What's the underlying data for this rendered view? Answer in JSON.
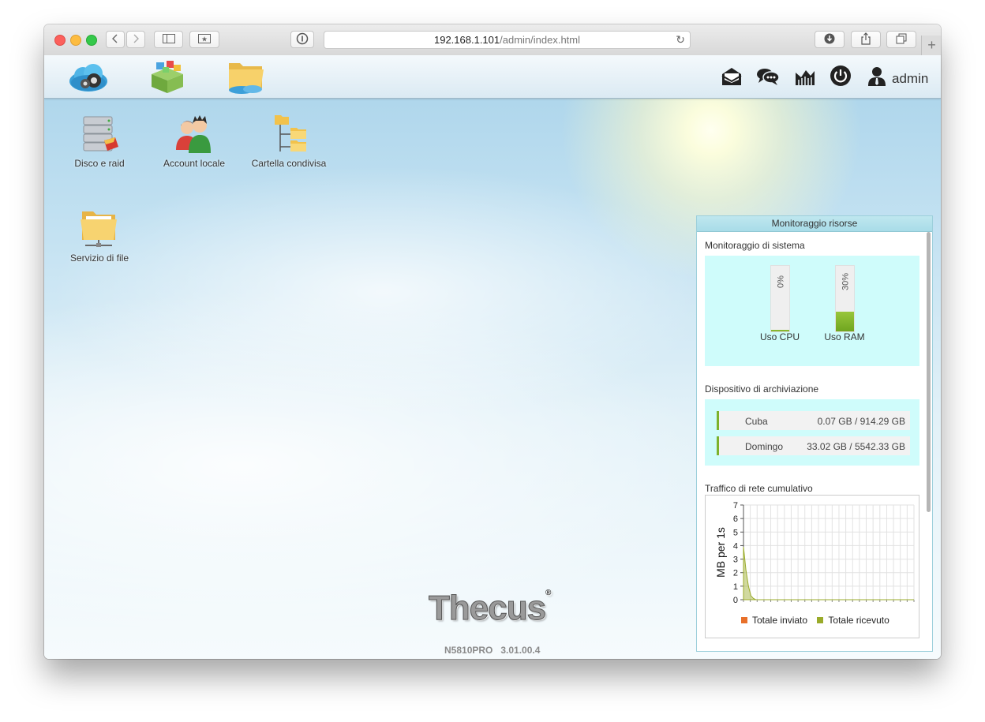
{
  "browser": {
    "address_host": "192.168.1.101",
    "address_path": "/admin/index.html",
    "reload_glyph": "↻",
    "new_tab_glyph": "+",
    "icons": [
      "back-icon",
      "forward-icon",
      "sidebar-icon",
      "bookmarks-icon",
      "reader-icon",
      "reload-icon",
      "download-icon",
      "share-icon",
      "tabs-icon"
    ]
  },
  "topbar": {
    "app_icons": [
      "cloud-settings-icon",
      "app-center-icon",
      "file-station-icon"
    ],
    "right_icons": [
      "message-icon",
      "chat-icon",
      "monitor-icon",
      "power-icon",
      "user-icon"
    ],
    "user_label": "admin"
  },
  "desktop": {
    "items": [
      {
        "label": "Disco e raid",
        "icon": "disk-raid-icon"
      },
      {
        "label": "Account locale",
        "icon": "local-account-icon"
      },
      {
        "label": "Cartella condivisa",
        "icon": "shared-folder-icon"
      },
      {
        "label": "Servizio di file",
        "icon": "file-service-icon"
      }
    ]
  },
  "branding": {
    "logo": "Thecus",
    "reg_mark": "®",
    "version": "N5810PRO   3.01.00.4"
  },
  "monitor": {
    "title": "Monitoraggio risorse",
    "system_title": "Monitoraggio di sistema",
    "cpu": {
      "label": "Uso CPU",
      "percent_text": "0%",
      "level": 0.02
    },
    "ram": {
      "label": "Uso RAM",
      "percent_text": "30%",
      "level": 0.3
    },
    "storage_title": "Dispositivo di archiviazione",
    "disks": [
      {
        "name": "Cuba",
        "usage": "0.07 GB / 914.29 GB"
      },
      {
        "name": "Domingo",
        "usage": "33.02 GB / 5542.33 GB"
      }
    ],
    "network_title": "Traffico di rete cumulativo",
    "colors": {
      "sent": "#e8702a",
      "received": "#9aab2a",
      "panel_header": "#a8dce8",
      "cyan_box": "#cffcfb"
    }
  },
  "chart_data": {
    "type": "area",
    "ylabel": "MB per 1s",
    "xlabel": "",
    "ylim": [
      0,
      7
    ],
    "yticks": [
      "0",
      "1",
      "2",
      "3",
      "4",
      "5",
      "6",
      "7"
    ],
    "grid": true,
    "legend_position": "bottom",
    "series": [
      {
        "name": "Totale inviato",
        "color": "#e8702a",
        "values": [
          0,
          0,
          0,
          0,
          0,
          0,
          0,
          0,
          0,
          0,
          0,
          0,
          0,
          0,
          0,
          0,
          0,
          0,
          0,
          0,
          0,
          0,
          0,
          0,
          0,
          0,
          0,
          0,
          0,
          0,
          0,
          0,
          0,
          0,
          0,
          0,
          0,
          0,
          0,
          0,
          0,
          0,
          0,
          0,
          0,
          0,
          0,
          0,
          0,
          0,
          0,
          0,
          0,
          0,
          0,
          0,
          0,
          0,
          0,
          0,
          0,
          0,
          0,
          0,
          0,
          0,
          0,
          0,
          0,
          0
        ]
      },
      {
        "name": "Totale ricevuto",
        "color": "#9aab2a",
        "values": [
          3.9,
          2.2,
          1.0,
          0.3,
          0.1,
          0,
          0,
          0,
          0,
          0,
          0,
          0,
          0,
          0,
          0,
          0,
          0,
          0,
          0,
          0,
          0,
          0,
          0,
          0,
          0,
          0,
          0,
          0,
          0,
          0,
          0,
          0,
          0,
          0,
          0,
          0,
          0,
          0,
          0,
          0,
          0,
          0,
          0,
          0,
          0,
          0,
          0,
          0,
          0,
          0,
          0,
          0,
          0,
          0,
          0,
          0,
          0,
          0,
          0,
          0,
          0,
          0,
          0,
          0,
          0,
          0,
          0,
          0,
          0,
          0
        ]
      }
    ]
  }
}
